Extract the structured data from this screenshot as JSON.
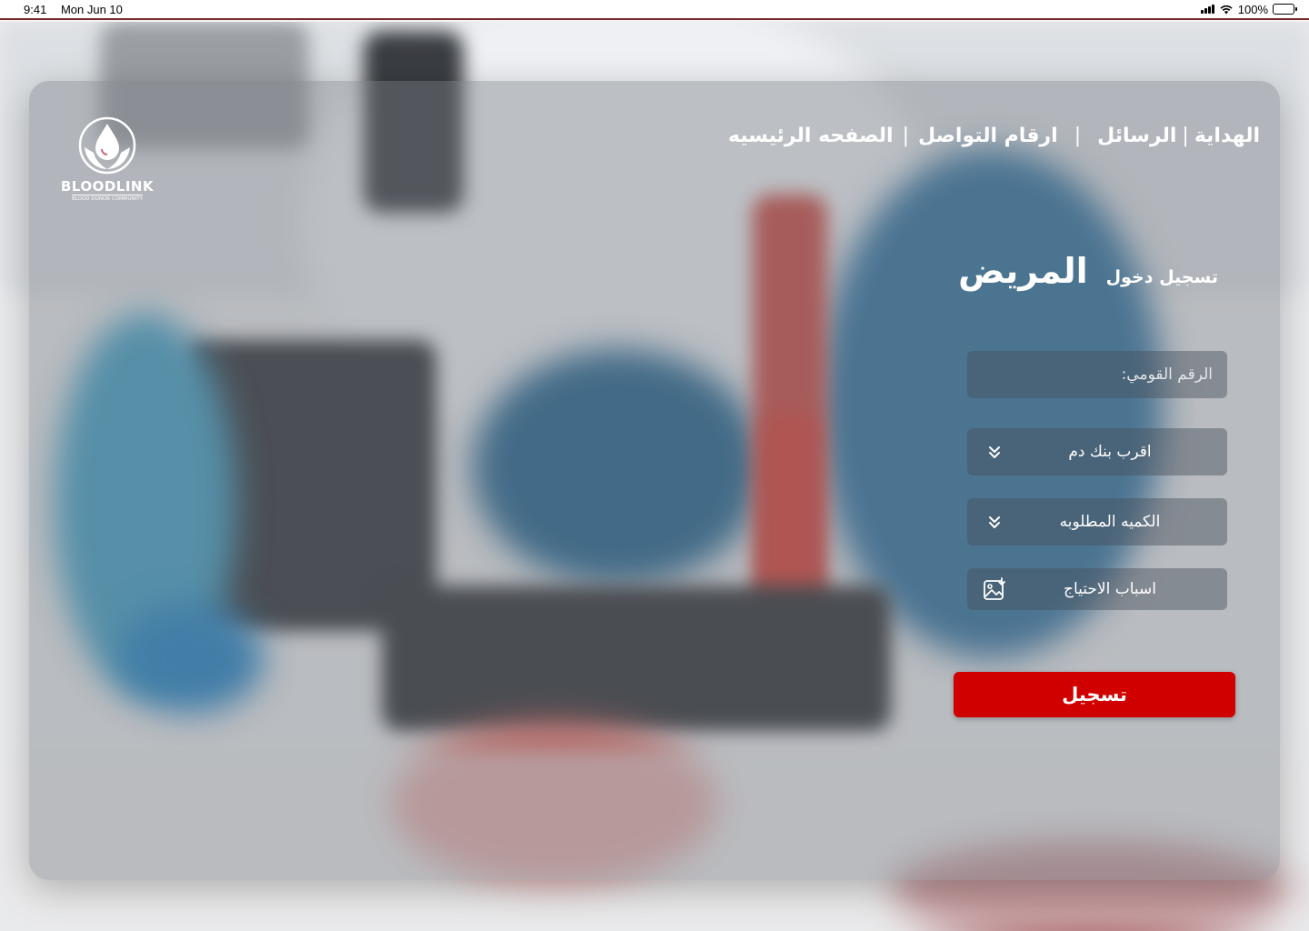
{
  "status_bar": {
    "time": "9:41",
    "date": "Mon Jun 10",
    "battery": "100%"
  },
  "logo": {
    "brand": "BLOODLINK",
    "tagline": "BLOOD DONOR COMMUNITY"
  },
  "nav": {
    "home": "الصفحه الرئيسيه",
    "contacts": "ارقام التواصل",
    "messages": "الرسائل",
    "gifts": "الهداية",
    "separator": "|"
  },
  "login": {
    "prefix": "تسجيل دخول",
    "role": "المريض"
  },
  "form": {
    "national_id_placeholder": "الرقم القومي:",
    "nearest_bank": "اقرب بنك دم",
    "quantity": "الكميه المطلوبه",
    "reasons": "اسباب الاحتياج",
    "submit": "تسجيل"
  },
  "colors": {
    "accent": "#d10000",
    "card": "#787c82"
  },
  "icons": {
    "dropdown": "double-chevron-down-icon",
    "upload": "image-upload-icon"
  }
}
